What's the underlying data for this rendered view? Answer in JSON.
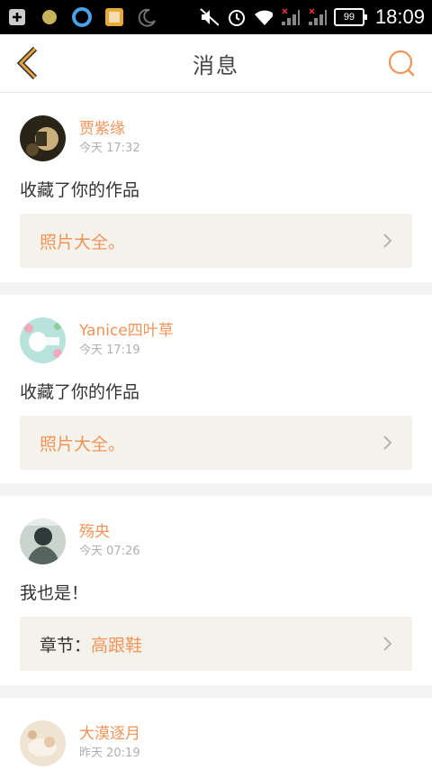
{
  "statusbar": {
    "time": "18:09",
    "battery": "99"
  },
  "header": {
    "title": "消息",
    "back_icon": "chevron-left-icon",
    "search_icon": "search-icon"
  },
  "colors": {
    "accent": "#f0955a",
    "back": "#e8a33b",
    "link_bg": "#f4f2eb"
  },
  "messages": [
    {
      "name": "贾紫缘",
      "time": "今天 17:32",
      "content": "收藏了你的作品",
      "link_prefix": "",
      "link": "照片大全。"
    },
    {
      "name": "Yanice四叶草",
      "time": "今天 17:19",
      "content": "收藏了你的作品",
      "link_prefix": "",
      "link": "照片大全。"
    },
    {
      "name": "殇央",
      "time": "今天 07:26",
      "content": "我也是！",
      "link_prefix": "章节：",
      "link": "高跟鞋"
    },
    {
      "name": "大漠逐月",
      "time": "昨天 20:19"
    }
  ]
}
